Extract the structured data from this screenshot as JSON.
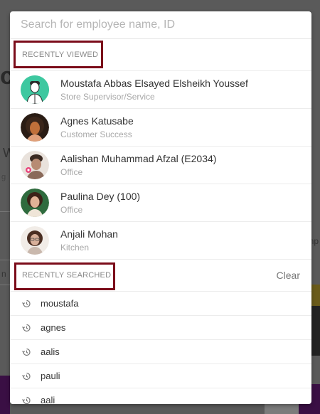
{
  "search": {
    "placeholder": "Search for employee name, ID"
  },
  "recently_viewed": {
    "label": "RECENTLY VIEWED",
    "people": [
      {
        "name": "Moustafa Abbas Elsayed Elsheikh Youssef",
        "role": "Store Supervisor/Service",
        "avatar": "illustrated-avatar",
        "avatar_color": "#3ec8a0"
      },
      {
        "name": "Agnes Katusabe",
        "role": "Customer Success",
        "avatar": "photo-avatar",
        "avatar_color": "#c0703a"
      },
      {
        "name": "Aalishan Muhammad Afzal (E2034)",
        "role": "Office",
        "avatar": "photo-avatar",
        "avatar_color": "#b78b73"
      },
      {
        "name": "Paulina Dey (100)",
        "role": "Office",
        "avatar": "photo-avatar",
        "avatar_color": "#2f6b3e"
      },
      {
        "name": "Anjali Mohan",
        "role": "Kitchen",
        "avatar": "photo-avatar",
        "avatar_color": "#d8c7bd"
      }
    ]
  },
  "recently_searched": {
    "label": "RECENTLY SEARCHED",
    "clear_label": "Clear",
    "items": [
      "moustafa",
      "agnes",
      "aalis",
      "pauli",
      "aali"
    ]
  },
  "colors": {
    "highlight": "#7b0c1a",
    "overlay": "#5a5a5a"
  }
}
